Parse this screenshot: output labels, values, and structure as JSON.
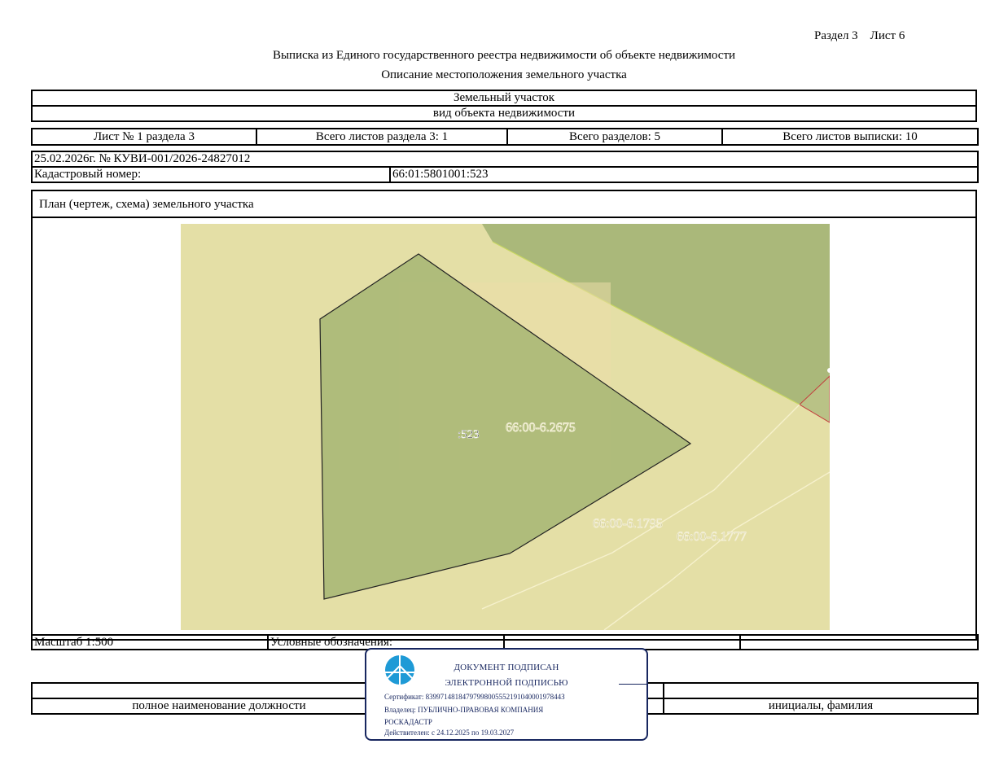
{
  "header": {
    "sheet_info": "Раздел 3    Лист 6",
    "title": "Выписка из Единого государственного реестра недвижимости об объекте недвижимости",
    "subtitle": "Описание местоположения земельного участка"
  },
  "object": {
    "type": "Земельный участок",
    "type_caption": "вид объекта недвижимости"
  },
  "sheets_row": {
    "sheet_of_section": "Лист № 1 раздела 3",
    "sheets_in_section": "Всего листов раздела 3: 1",
    "total_sections": "Всего разделов: 5",
    "total_sheets": "Всего листов выписки: 10"
  },
  "record": {
    "date_number": "25.02.2026г. № КУВИ-001/2026-24827012",
    "cadastral_label": "Кадастровый номер:",
    "cadastral_value": "66:01:5801001:523"
  },
  "plan": {
    "heading": "План (чертеж, схема) земельного участка",
    "labels": {
      "parcel": ":523",
      "zone_main": "66:00-6.2675",
      "zone_a": "66:00-6.1795",
      "zone_b": "66:00-6.1777"
    },
    "colors": {
      "background": "#e4dfa6",
      "zone_dark": "#aab87a",
      "parcel_fill": "#aab877",
      "highlight": "#ebdda8",
      "boundary_red": "#c33c3c"
    }
  },
  "footer": {
    "scale": "Масштаб 1:500",
    "legend_label": "Условные обозначения:",
    "position_caption": "полное наименование должности",
    "name_caption": "инициалы, фамилия"
  },
  "stamp": {
    "line1": "ДОКУМЕНТ ПОДПИСАН",
    "line2": "ЭЛЕКТРОННОЙ ПОДПИСЬЮ",
    "certificate": "Сертификат: 8399714818479799800555219104000197844З",
    "owner": "Владелец: ПУБЛИЧНО-ПРАВОВАЯ КОМПАНИЯ",
    "owner_cont": "РОСКАДАСТР",
    "valid": "Действителен: с 24.12.2025 по 19.03.2027",
    "color": "#17265f",
    "logo_color": "#1e9ad6"
  }
}
